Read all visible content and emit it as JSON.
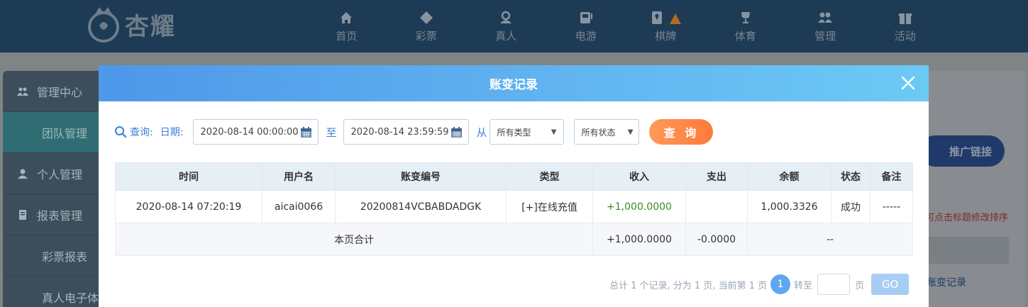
{
  "brand": {
    "name": "杏耀"
  },
  "nav": [
    {
      "label": "首页",
      "icon": "home-icon"
    },
    {
      "label": "彩票",
      "icon": "lottery-icon"
    },
    {
      "label": "真人",
      "icon": "live-dealer-icon"
    },
    {
      "label": "电游",
      "icon": "slot-icon"
    },
    {
      "label": "棋牌",
      "icon": "cards-icon"
    },
    {
      "label": "体育",
      "icon": "trophy-icon"
    },
    {
      "label": "管理",
      "icon": "users-icon"
    },
    {
      "label": "活动",
      "icon": "gift-icon"
    }
  ],
  "sidebar": {
    "items": [
      {
        "label": "管理中心",
        "icon": "users-icon"
      },
      {
        "label": "团队管理"
      },
      {
        "label": "个人管理",
        "icon": "user-icon"
      },
      {
        "label": "报表管理",
        "icon": "report-icon"
      },
      {
        "label": "彩票报表"
      },
      {
        "label": "真人电子体"
      }
    ]
  },
  "background": {
    "promo_button": "推广链接",
    "sort_hint": "可点击标题修改排序",
    "link": "账变记录"
  },
  "modal": {
    "title": "账变记录",
    "query": {
      "query_label": "查询:",
      "date_label": "日期:",
      "start_date": "2020-08-14 00:00:00",
      "to_label": "至",
      "end_date": "2020-08-14 23:59:59",
      "from_label": "从",
      "type_select": "所有类型",
      "status_select": "所有状态",
      "search_button": "查 询"
    },
    "table": {
      "headers": [
        "时间",
        "用户名",
        "账变编号",
        "类型",
        "收入",
        "支出",
        "余额",
        "状态",
        "备注"
      ],
      "rows": [
        [
          "2020-08-14 07:20:19",
          "aicai0066",
          "20200814VCBABDADGK",
          "[+]在线充值",
          "+1,000.0000",
          "",
          "1,000.3326",
          "成功",
          "-----"
        ]
      ],
      "summary": {
        "label": "本页合计",
        "income": "+1,000.0000",
        "expense": "-0.0000",
        "balance": "--"
      }
    },
    "pager": {
      "summary": "总计 1 个记录, 分为 1 页, 当前第 1 页",
      "current": "1",
      "goto_label": "转至",
      "page_label": "页",
      "go_button": "GO"
    }
  },
  "colors": {
    "header_gradient_start": "#4e97e9",
    "header_gradient_end": "#6cc9f4",
    "search_button": "#ff8a48",
    "income_text": "#3d8a1e",
    "accent_blue": "#3b7fd8"
  }
}
